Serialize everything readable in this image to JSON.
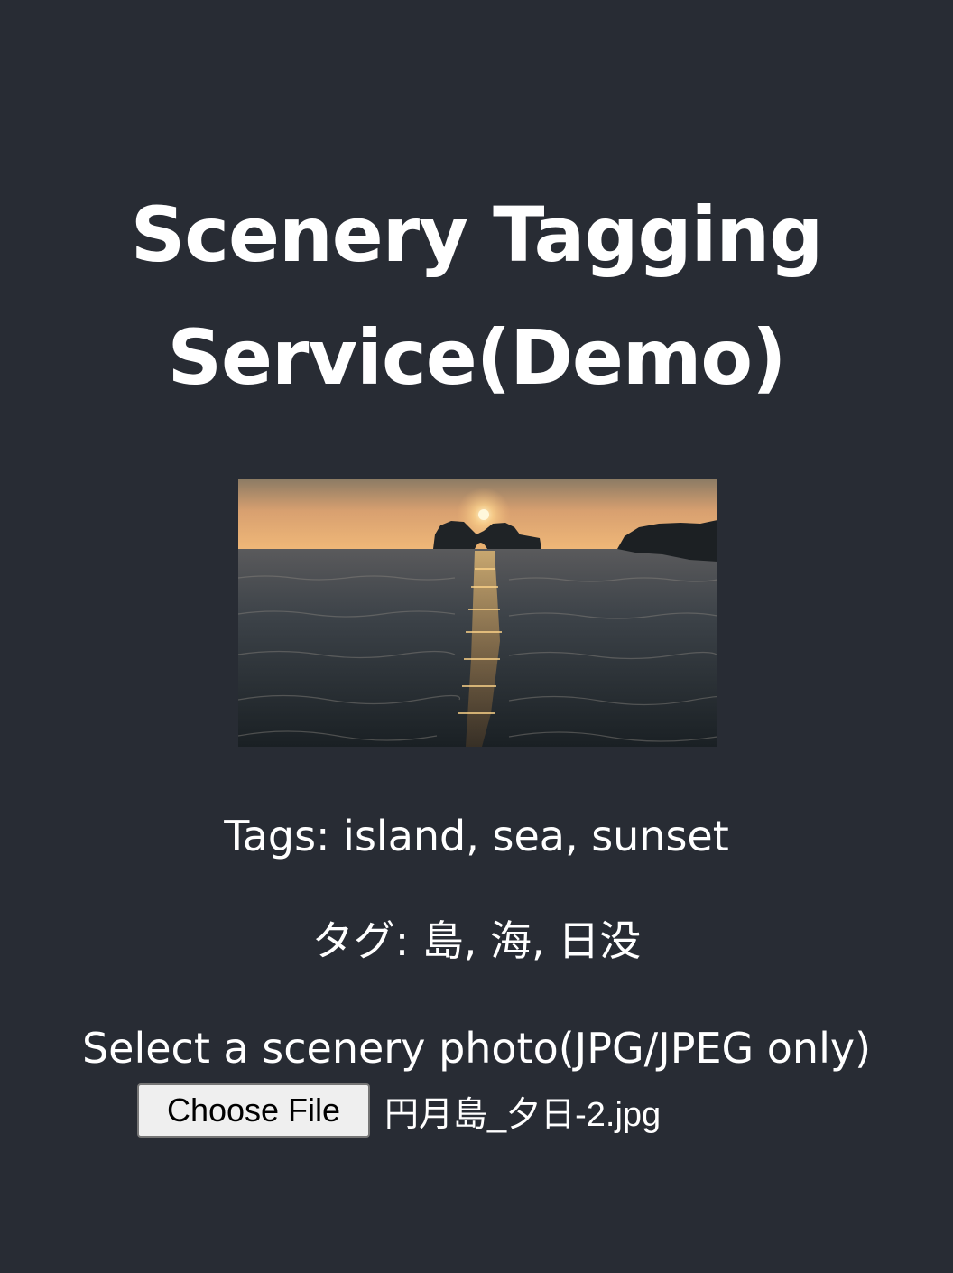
{
  "page": {
    "background_color": "#282c34",
    "text_color": "#ffffff",
    "title": "Scenery Tagging Service(Demo)"
  },
  "photo": {
    "alt": "円月島_夕日-2.jpg",
    "description_icon": "uploaded-photo"
  },
  "tags": {
    "english_line": "Tags: island, sea, sunset",
    "japanese_line": "タグ: 島, 海, 日没"
  },
  "upload": {
    "label": "Select a scenery photo(JPG/JPEG only)",
    "button_label": "Choose File",
    "selected_file": "円月島_夕日-2.jpg",
    "button_color": "#efefef"
  }
}
